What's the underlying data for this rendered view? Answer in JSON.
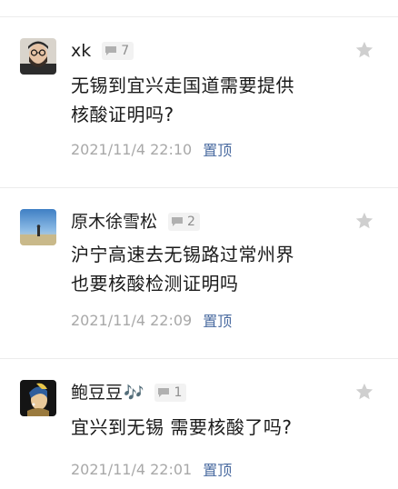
{
  "comments": [
    {
      "username": "xk",
      "reply_count": "7",
      "content_lines": [
        "无锡到宜兴走国道需要提供",
        "核酸证明吗?"
      ],
      "timestamp": "2021/11/4 22:10",
      "pin_label": "置顶",
      "avatar_icon": "man-with-beard-avatar"
    },
    {
      "username": "原木徐雪松",
      "reply_count": "2",
      "content_lines": [
        "沪宁高速去无锡路过常州界",
        "也要核酸检测证明吗"
      ],
      "timestamp": "2021/11/4 22:09",
      "pin_label": "置顶",
      "avatar_icon": "sky-landscape-avatar"
    },
    {
      "username": "鲍豆豆",
      "username_emoji": "🎶",
      "reply_count": "1",
      "content_lines": [
        "宜兴到无锡 需要核酸了吗?"
      ],
      "timestamp": "2021/11/4 22:01",
      "pin_label": "置顶",
      "avatar_icon": "pearl-earring-portrait-avatar"
    }
  ],
  "icons": {
    "star": "star-icon",
    "reply": "speech-bubble-icon"
  },
  "colors": {
    "pin_link": "#4a6ba0",
    "timestamp": "#a8a8a8",
    "star": "#cfcfcf"
  }
}
